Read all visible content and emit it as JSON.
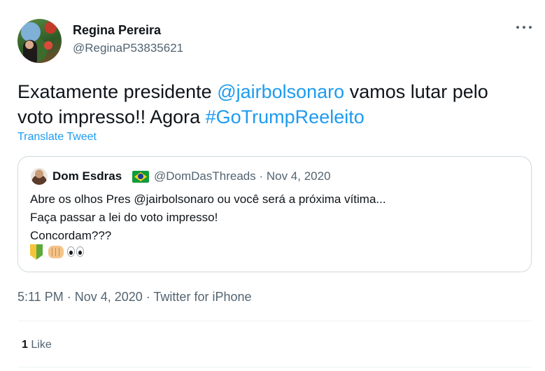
{
  "tweet": {
    "author_name": "Regina Pereira",
    "author_handle": "@ReginaP53835621",
    "text_before": "Exatamente presidente ",
    "mention": "@jairbolsonaro",
    "text_middle": " vamos lutar pelo voto impresso!! Agora ",
    "hashtag": "#GoTrumpReeleito",
    "translate_label": "Translate Tweet",
    "timestamp": "5:11 PM · Nov 4, 2020 · Twitter for iPhone",
    "like_count": "1",
    "like_label": "Like"
  },
  "quoted": {
    "author_name": "Dom Esdras",
    "meta": "@DomDasThreads · Nov 4, 2020",
    "text": "Abre os olhos Pres @jairbolsonaro ou você será a próxima vítima...\nFaça passar a lei do voto impresso!\nConcordam???"
  },
  "icons": {
    "more": "more-horizontal-icon",
    "flag": "brazil-flag-icon",
    "emojis": [
      "beginner-symbol-icon",
      "fist-icon",
      "eyes-icon"
    ]
  },
  "colors": {
    "link": "#1d9bf0",
    "secondary": "#536471",
    "border": "#cfd9de"
  }
}
